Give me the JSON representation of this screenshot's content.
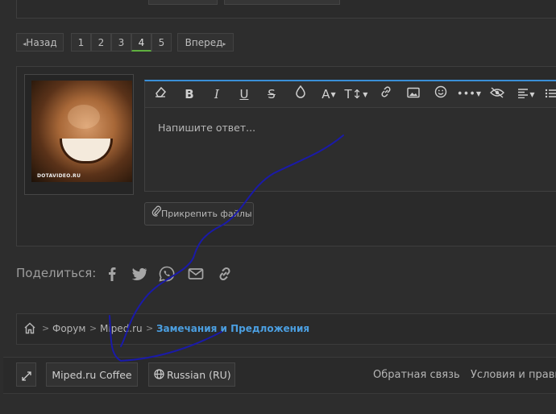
{
  "pagination": {
    "prev_label": "Назад",
    "pages": [
      "1",
      "2",
      "3",
      "4",
      "5"
    ],
    "current_page": "4",
    "next_label": "Вперед"
  },
  "avatar": {
    "watermark": "DOTAVIDEO.RU"
  },
  "editor": {
    "placeholder": "Напишите ответ...",
    "toolbar_icons": [
      "eraser-icon",
      "bold-icon",
      "italic-icon",
      "underline-icon",
      "strikethrough-icon",
      "color-drop-icon",
      "font-color-icon",
      "font-size-icon",
      "link-icon",
      "image-icon",
      "emoji-icon",
      "more-icon",
      "hide-icon",
      "align-icon",
      "list-icon"
    ],
    "accent_color": "#3a8fd8"
  },
  "attach": {
    "label": "Прикрепить файлы"
  },
  "share": {
    "label": "Поделиться:",
    "icons": [
      "facebook-icon",
      "twitter-icon",
      "whatsapp-icon",
      "email-icon",
      "link-icon"
    ]
  },
  "breadcrumb": {
    "items": [
      "Форум",
      "Miped.ru",
      "Замечания и Предложения"
    ],
    "active_color": "#4b9fe1"
  },
  "footer": {
    "style_label": "Miped.ru Coffee",
    "language_label": "Russian (RU)",
    "links": [
      "Обратная связь",
      "Условия и прави"
    ]
  },
  "annotation": {
    "stroke_color": "#1a1aa8"
  }
}
